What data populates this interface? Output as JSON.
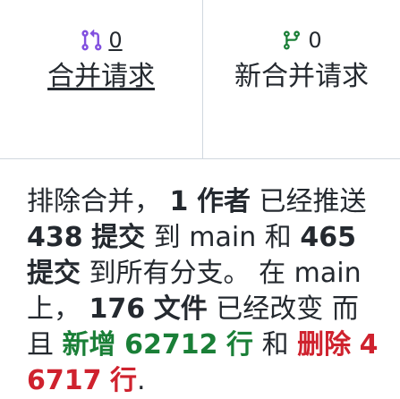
{
  "pulse": {
    "merged_prs": {
      "count": "0",
      "label": "合并请求",
      "icon": "git-pull-request-icon",
      "icon_color": "#8250df"
    },
    "new_prs": {
      "count": "0",
      "label": "新合并请求",
      "icon": "git-branch-icon",
      "icon_color": "#1a7f37"
    },
    "summary": {
      "s1": "排除合并，",
      "authors": "1",
      "authors_label": "作者",
      "s2": "已经推送",
      "commits_main": "438",
      "commits_label_1": "提交",
      "s3": "到",
      "branch_1": "main",
      "s4": "和",
      "commits_all": "465",
      "commits_label_2": "提交",
      "s5": "到所有分支。",
      "s6": "在",
      "branch_2": "main",
      "s7": "上，",
      "files": "176",
      "files_label": "文件",
      "s8": "已经改变",
      "s9": "而且",
      "add_label": "新增",
      "additions": "62712",
      "lines_label_1": "行",
      "s10": "和",
      "del_label": "删除",
      "deletions": "46717",
      "lines_label_2": "行",
      "end": ".",
      "add_color": "#1a7f37",
      "del_color": "#cf222e"
    }
  }
}
